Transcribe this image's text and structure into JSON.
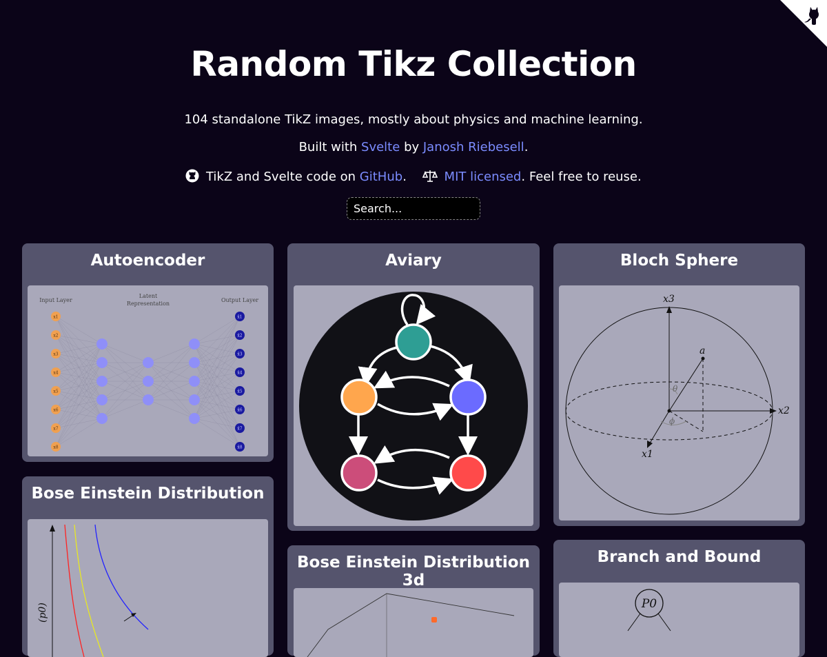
{
  "header": {
    "title": "Random Tikz Collection",
    "subtitle": "104 standalone TikZ images, mostly about physics and machine learning.",
    "built_with": "Built with",
    "svelte": "Svelte",
    "by": "by",
    "author": "Janosh Riebesell",
    "period": ".",
    "code_prefix": "TikZ and Svelte code on",
    "github": "GitHub",
    "code_suffix": ".",
    "license": "MIT licensed",
    "license_suffix": ". Feel free to reuse."
  },
  "search": {
    "placeholder": "Search..."
  },
  "cards": [
    {
      "title": "Autoencoder"
    },
    {
      "title": "Aviary"
    },
    {
      "title": "Bloch Sphere"
    },
    {
      "title": "Bose Einstein Distribution"
    },
    {
      "title": "Bose Einstein Distribution 3d"
    },
    {
      "title": "Branch and Bound"
    }
  ],
  "figures": {
    "autoencoder": {
      "input_label": "Input Layer",
      "latent_label_1": "Latent",
      "latent_label_2": "Representation",
      "output_label": "Output Layer",
      "inputs": [
        "x1",
        "x2",
        "x3",
        "x4",
        "x5",
        "x6",
        "x7",
        "x8"
      ],
      "outputs": [
        "x̂1",
        "x̂2",
        "x̂3",
        "x̂4",
        "x̂5",
        "x̂6",
        "x̂7",
        "x̂8"
      ]
    },
    "bloch": {
      "x1": "x1",
      "x2": "x2",
      "x3": "x3",
      "a": "a",
      "theta": "θ",
      "phi": "ϕ"
    },
    "bose": {
      "ylabel": "(p0)"
    },
    "branch": {
      "root": "P0"
    }
  },
  "colors": {
    "background": "#0b0418",
    "card": "#55546d",
    "figure": "#a9a8ba",
    "link": "#7b8cff",
    "teal": "#2e9e94",
    "orange": "#ffa64d",
    "purple": "#6b6bff",
    "magenta": "#cc4d7a",
    "red": "#ff4a4a"
  }
}
